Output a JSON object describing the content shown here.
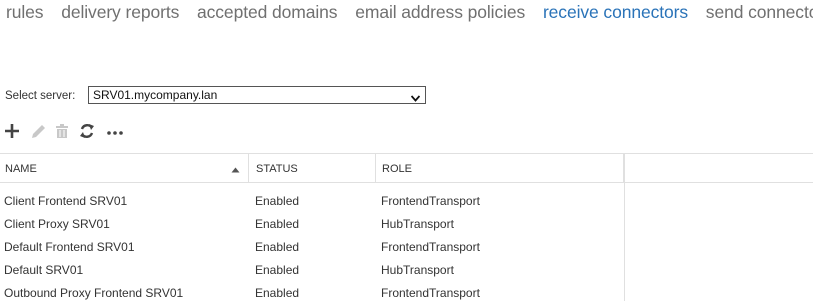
{
  "nav": {
    "tabs": [
      {
        "label": "rules"
      },
      {
        "label": "delivery reports"
      },
      {
        "label": "accepted domains"
      },
      {
        "label": "email address policies"
      },
      {
        "label": "receive connectors"
      },
      {
        "label": "send connectors"
      }
    ],
    "active_tab": "receive connectors",
    "active_color": "#2a73b8"
  },
  "server": {
    "label": "Select server:",
    "value": "SRV01.mycompany.lan"
  },
  "toolbar": {
    "icons": [
      "add-icon",
      "edit-icon",
      "delete-icon",
      "refresh-icon",
      "more-icon"
    ]
  },
  "grid": {
    "columns": {
      "name": "NAME",
      "status": "STATUS",
      "role": "ROLE"
    },
    "sort": "ascending",
    "rows": [
      {
        "name": "Client Frontend SRV01",
        "status": "Enabled",
        "role": "FrontendTransport"
      },
      {
        "name": "Client Proxy SRV01",
        "status": "Enabled",
        "role": "HubTransport"
      },
      {
        "name": "Default Frontend SRV01",
        "status": "Enabled",
        "role": "FrontendTransport"
      },
      {
        "name": "Default SRV01",
        "status": "Enabled",
        "role": "HubTransport"
      },
      {
        "name": "Outbound Proxy Frontend SRV01",
        "status": "Enabled",
        "role": "FrontendTransport"
      }
    ]
  }
}
